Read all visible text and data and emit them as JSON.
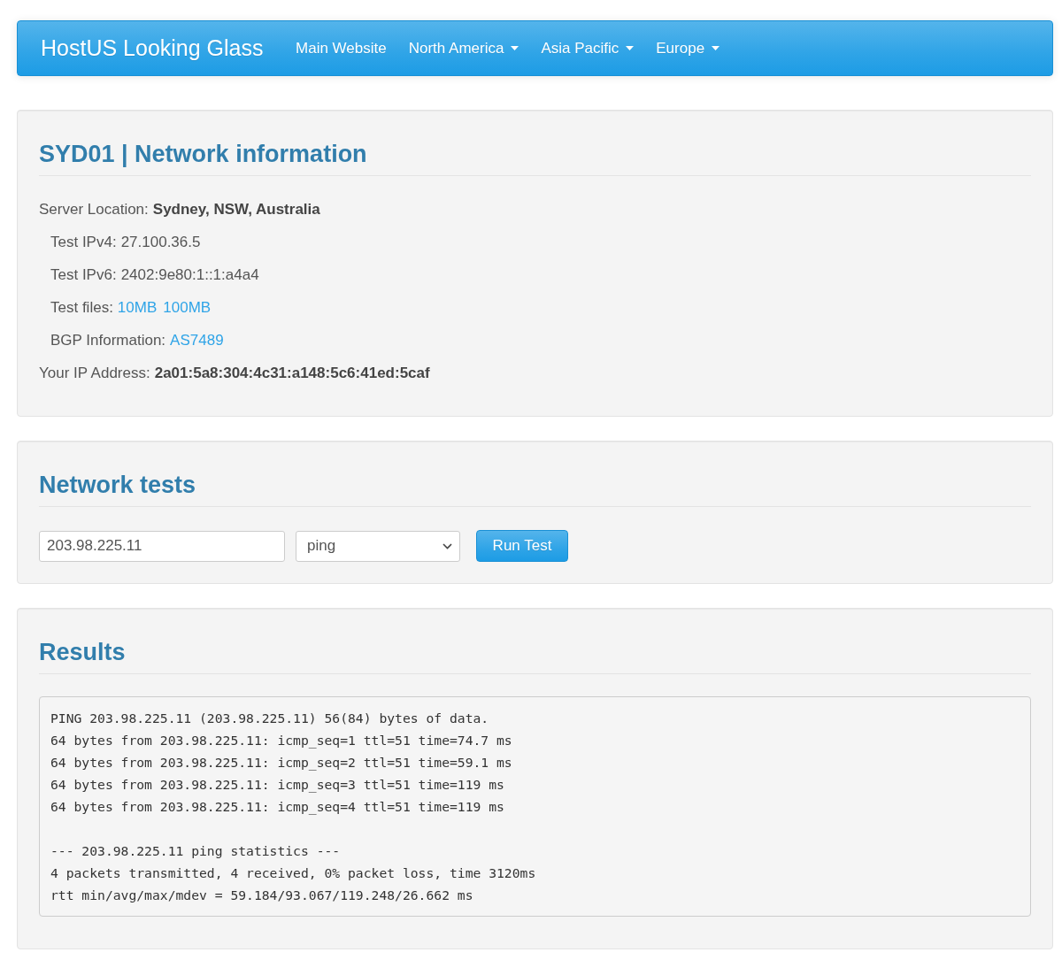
{
  "navbar": {
    "brand": "HostUS Looking Glass",
    "links": [
      {
        "label": "Main Website",
        "dropdown": false
      },
      {
        "label": "North America",
        "dropdown": true
      },
      {
        "label": "Asia Pacific",
        "dropdown": true
      },
      {
        "label": "Europe",
        "dropdown": true
      }
    ]
  },
  "network_information": {
    "title": "SYD01 | Network information",
    "rows": [
      {
        "kind": "strong",
        "label": "Server Location:",
        "value": "Sydney, NSW, Australia"
      },
      {
        "kind": "plain",
        "label": "Test IPv4:",
        "value": "27.100.36.5"
      },
      {
        "kind": "plain",
        "label": "Test IPv6:",
        "value": "2402:9e80:1::1:a4a4"
      },
      {
        "kind": "links",
        "label": "Test files:",
        "links": [
          "10MB",
          "100MB"
        ]
      },
      {
        "kind": "links",
        "label": "BGP Information:",
        "links": [
          "AS7489"
        ]
      },
      {
        "kind": "strong",
        "label": "Your IP Address:",
        "value": "2a01:5a8:304:4c31:a148:5c6:41ed:5caf"
      }
    ]
  },
  "network_tests": {
    "title": "Network tests",
    "host": {
      "value": "203.98.225.11"
    },
    "test_type": {
      "value": "ping"
    },
    "button": "Run Test"
  },
  "results": {
    "title": "Results",
    "output": [
      [
        "PING 203.98.225.11 (203.98.225.11) 56(84) bytes of data.",
        "64 bytes from 203.98.225.11: icmp_seq=1 ttl=51 time=74.7 ms",
        "64 bytes from 203.98.225.11: icmp_seq=2 ttl=51 time=59.1 ms",
        "64 bytes from 203.98.225.11: icmp_seq=3 ttl=51 time=119 ms",
        "64 bytes from 203.98.225.11: icmp_seq=4 ttl=51 time=119 ms"
      ],
      [
        "--- 203.98.225.11 ping statistics ---",
        "4 packets transmitted, 4 received, 0% packet loss, time 3120ms",
        "rtt min/avg/max/mdev = 59.184/93.067/119.248/26.662 ms"
      ]
    ]
  }
}
